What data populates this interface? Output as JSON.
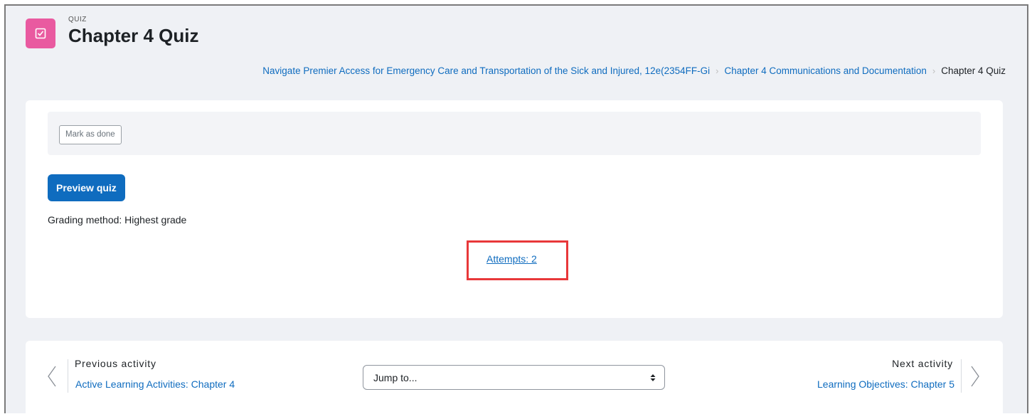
{
  "header": {
    "kicker": "QUIZ",
    "title": "Chapter 4 Quiz",
    "icon": "quiz-checkbox-icon",
    "icon_color": "#e95aa0"
  },
  "breadcrumb": {
    "items": [
      "Navigate Premier Access for Emergency Care and Transportation of the Sick and Injured, 12e(2354FF-Gi",
      "Chapter 4 Communications and Documentation"
    ],
    "current": "Chapter 4 Quiz"
  },
  "main": {
    "mark_done_label": "Mark as done",
    "preview_label": "Preview quiz",
    "grading_text": "Grading method: Highest grade",
    "attempts_text": "Attempts: 2"
  },
  "activity_nav": {
    "prev_label": "Previous activity",
    "prev_link": "Active Learning Activities: Chapter 4",
    "jump_placeholder": "Jump to...",
    "next_label": "Next activity",
    "next_link": "Learning Objectives: Chapter 5"
  },
  "colors": {
    "accent": "#0f6cbf",
    "highlight": "#e8383a",
    "background": "#eff1f5"
  }
}
